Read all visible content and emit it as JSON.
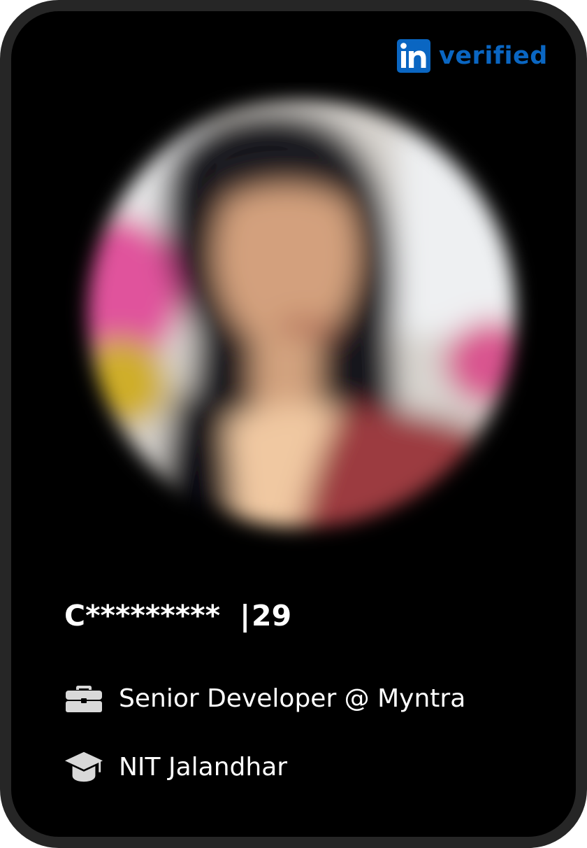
{
  "badge": {
    "logo_text": "in",
    "label": "verified",
    "logo_icon": "linkedin-icon",
    "color": "#0a66c2"
  },
  "profile": {
    "photo": "profile-photo-blurred",
    "name": "C*********",
    "separator": "|",
    "age": "29",
    "job": {
      "icon": "briefcase-icon",
      "text": "Senior Developer @ Myntra"
    },
    "education": {
      "icon": "graduation-cap-icon",
      "text": "NIT Jalandhar"
    }
  },
  "colors": {
    "card_background": "#000000",
    "card_border": "#262626",
    "text": "#ffffff",
    "icon": "#d9d9d9"
  }
}
